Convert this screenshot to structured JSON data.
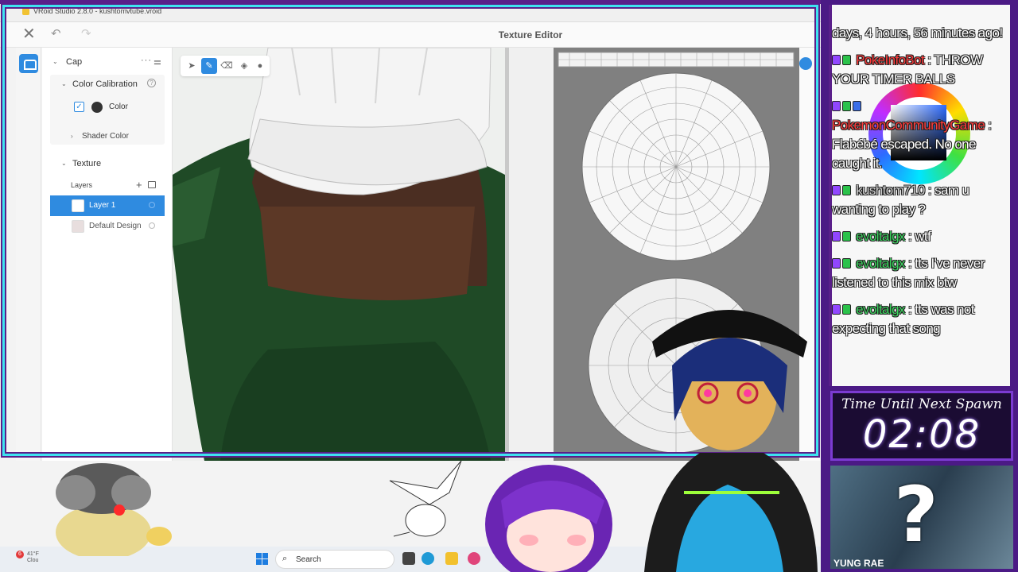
{
  "window": {
    "title": "VRoid Studio 2.8.0 - kushtomvtube.vroid"
  },
  "editor": {
    "title": "Texture Editor",
    "close_icon": "close-icon",
    "undo_icon": "undo-icon",
    "redo_icon": "redo-icon"
  },
  "panel": {
    "section_title": "Cap",
    "color_calibration": {
      "label": "Color Calibration",
      "checkbox_label": "Color",
      "checked": true,
      "swatch_color": "#333333"
    },
    "shader_color": {
      "label": "Shader Color"
    },
    "texture": {
      "label": "Texture",
      "layers_label": "Layers"
    },
    "layers": [
      {
        "label": "Layer 1",
        "selected": true
      },
      {
        "label": "Default Design",
        "selected": false
      }
    ]
  },
  "tools": [
    "select-tool-icon",
    "pen-tool-icon",
    "eraser-tool-icon",
    "fill-tool-icon",
    "dropper-tool-icon"
  ],
  "taskbar": {
    "search_placeholder": "Search",
    "notification_count": "6",
    "weather_text": "41°F Clou"
  },
  "chat": {
    "messages": [
      {
        "user": "",
        "text": "days, 4 hours, 56 minutes ago!"
      },
      {
        "user": "PokeInfoBot",
        "user_color": "#ff3a3a",
        "text": ": THROW YOUR TIMER BALLS"
      },
      {
        "user": "PokemonCommunityGame",
        "user_color": "#ff3a3a",
        "text": ": Flabébé escaped. No one caught it."
      },
      {
        "user": "kushtom710",
        "user_color": "#cfcfcf",
        "text": ": sam u wanting to play ?"
      },
      {
        "user": "evoltalgx",
        "user_color": "#3bd35f",
        "text": ": wtf"
      },
      {
        "user": "evoltalgx",
        "user_color": "#3bd35f",
        "text": ": tts I've never listened to this mix btw"
      },
      {
        "user": "evoltalgx",
        "user_color": "#3bd35f",
        "text": ": tts was not expecting that song"
      }
    ]
  },
  "timer": {
    "label": "Time Until Next Spawn",
    "value": "02:08"
  },
  "mystery": {
    "caption": "YUNG RAE"
  },
  "colors": {
    "accent": "#2f8be0",
    "frame_cyan": "#3ee3f0",
    "frame_purple": "#5a1f8a"
  }
}
